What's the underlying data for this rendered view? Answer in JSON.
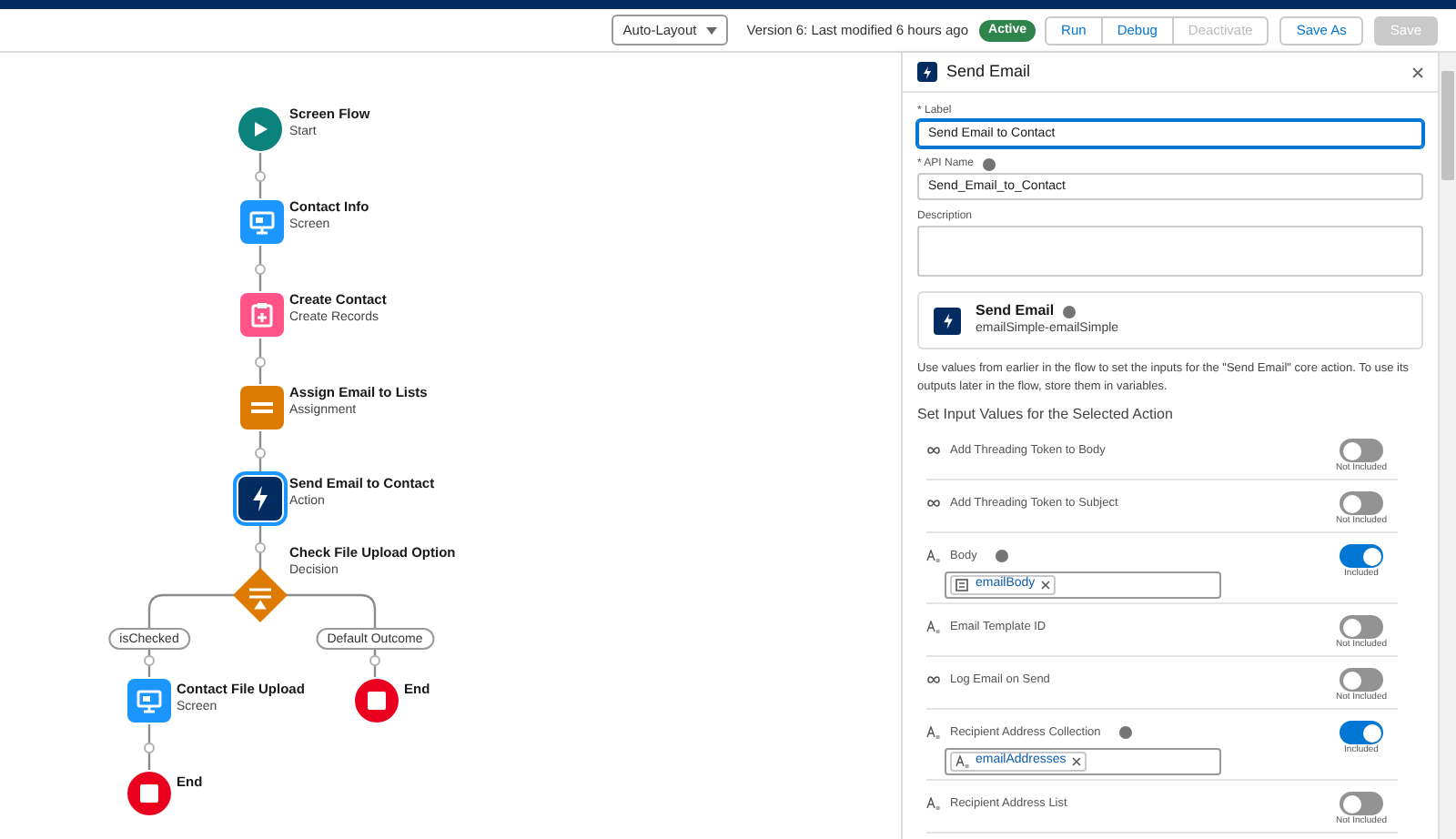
{
  "toolbar": {
    "layout_select": "Auto-Layout",
    "version": "Version 6: Last modified 6 hours ago",
    "status": "Active",
    "buttons": [
      {
        "label": "Run",
        "disabled": false,
        "kind": "neutral"
      },
      {
        "label": "Debug",
        "disabled": false,
        "kind": "neutral"
      },
      {
        "label": "Deactivate",
        "disabled": true,
        "kind": "neutral"
      },
      {
        "label": "Save As",
        "disabled": false,
        "kind": "neutral"
      },
      {
        "label": "Save",
        "disabled": true,
        "kind": "brand"
      }
    ]
  },
  "flow": {
    "nodes": [
      {
        "kind": "start",
        "title": "Screen Flow",
        "subtitle": "Start",
        "selected": false
      },
      {
        "kind": "screen",
        "title": "Contact Info",
        "subtitle": "Screen",
        "selected": false
      },
      {
        "kind": "create",
        "title": "Create Contact",
        "subtitle": "Create Records",
        "selected": false
      },
      {
        "kind": "assignment",
        "title": "Assign Email to Lists",
        "subtitle": "Assignment",
        "selected": false
      },
      {
        "kind": "action",
        "title": "Send Email to Contact",
        "subtitle": "Action",
        "selected": true
      },
      {
        "kind": "decision",
        "title": "Check File Upload Option",
        "subtitle": "Decision",
        "selected": false
      },
      {
        "kind": "screen",
        "title": "Contact File Upload",
        "subtitle": "Screen",
        "selected": false
      },
      {
        "kind": "end",
        "title": "End",
        "selected": false
      },
      {
        "kind": "end",
        "title": "End",
        "selected": false
      }
    ],
    "branches": [
      "isChecked",
      "Default Outcome"
    ]
  },
  "panel": {
    "title": "Send Email",
    "fields": [
      {
        "label": "* Label",
        "info": false,
        "value": "Send Email to Contact",
        "focused": true,
        "kind": "input"
      },
      {
        "label": "* API Name",
        "info": true,
        "value": "Send_Email_to_Contact",
        "focused": false,
        "kind": "input"
      },
      {
        "label": "Description",
        "info": false,
        "focused": false,
        "kind": "textarea"
      }
    ],
    "action": {
      "name": "Send Email",
      "info": true,
      "api_name": "emailSimple-emailSimple"
    },
    "help": "Use values from earlier in the flow to set the inputs for the \"Send Email\" core action. To use its outputs later in the flow, store them in variables.",
    "section_title": "Set Input Values for the Selected Action",
    "params": [
      {
        "name": "Add Threading Token to Body",
        "kind": "boolean",
        "info": false,
        "included": false,
        "status": "Not Included"
      },
      {
        "name": "Add Threading Token to Subject",
        "kind": "boolean",
        "info": false,
        "included": false,
        "status": "Not Included"
      },
      {
        "name": "Body",
        "kind": "text",
        "info": true,
        "included": true,
        "status": "Included",
        "chip": {
          "label": "emailBody",
          "kind": "template"
        }
      },
      {
        "name": "Email Template ID",
        "kind": "text",
        "info": false,
        "included": false,
        "status": "Not Included"
      },
      {
        "name": "Log Email on Send",
        "kind": "boolean",
        "info": false,
        "included": false,
        "status": "Not Included"
      },
      {
        "name": "Recipient Address Collection",
        "kind": "text",
        "info": true,
        "included": true,
        "status": "Included",
        "chip": {
          "label": "emailAddresses",
          "kind": "text"
        }
      },
      {
        "name": "Recipient Address List",
        "kind": "text",
        "info": false,
        "included": false,
        "status": "Not Included"
      }
    ]
  }
}
